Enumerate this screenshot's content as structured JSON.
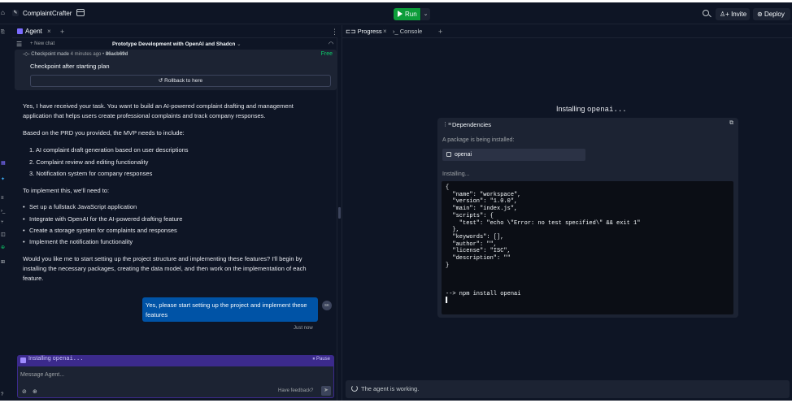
{
  "app": {
    "name": "ComplaintCrafter"
  },
  "toolbar": {
    "run_label": "Run",
    "invite_label": "Invite",
    "deploy_label": "Deploy"
  },
  "agent_tab": {
    "label": "Agent"
  },
  "chat": {
    "new_chat_label": "New chat",
    "title": "Prototype Development with OpenAI and Shadcn",
    "checkpoint_made": "Checkpoint made",
    "checkpoint_time": "4 minutes ago",
    "checkpoint_hash": "86acb69d",
    "checkpoint_badge": "Free",
    "checkpoint_text": "Checkpoint after starting plan",
    "rollback_label": "Rollback to here",
    "messages": {
      "p1": "Yes, I have received your task. You want to build an AI-powered complaint drafting and management application that helps users create professional complaints and track company responses.",
      "p2": "Based on the PRD you provided, the MVP needs to include:",
      "n1": "1. AI complaint draft generation based on user descriptions",
      "n2": "2. Complaint review and editing functionality",
      "n3": "3. Notification system for company responses",
      "p3": "To implement this, we'll need to:",
      "b1": "Set up a fullstack JavaScript application",
      "b2": "Integrate with OpenAI for the AI-powered drafting feature",
      "b3": "Create a storage system for complaints and responses",
      "b4": "Implement the notification functionality",
      "p4": "Would you like me to start setting up the project structure and implementing these features? I'll begin by installing the necessary packages, creating the data model, and then work on the implementation of each feature."
    },
    "user_message": "Yes, please start setting up the project and implement these features",
    "user_avatar": "SK",
    "timestamp": "Just now",
    "installing_label": "Installing",
    "installing_pkg": "openai...",
    "pause_label": "Pause",
    "input_placeholder": "Message Agent...",
    "feedback_label": "Have feedback?"
  },
  "right_tabs": {
    "progress_label": "Progress",
    "console_label": "Console"
  },
  "progress": {
    "heading_prefix": "Installing",
    "heading_pkg": "openai...",
    "deps_title": "Dependencies",
    "sub_label": "A package is being installed:",
    "package_name": "openai",
    "installing_label": "Installing...",
    "console_output": "{\n  \"name\": \"workspace\",\n  \"version\": \"1.0.0\",\n  \"main\": \"index.js\",\n  \"scripts\": {\n    \"test\": \"echo \\\"Error: no test specified\\\" && exit 1\"\n  },\n  \"keywords\": [],\n  \"author\": \"\",\n  \"license\": \"ISC\",\n  \"description\": \"\"\n}\n\n\n\n--> npm install openai\n▌",
    "status": "The agent is working."
  },
  "colors": {
    "run": "#0d9d3a",
    "bg": "#0e1525",
    "surface": "#1c2333",
    "accent": "#7b6cff",
    "user_bubble": "#0053a6",
    "free": "#0ccd6b"
  }
}
